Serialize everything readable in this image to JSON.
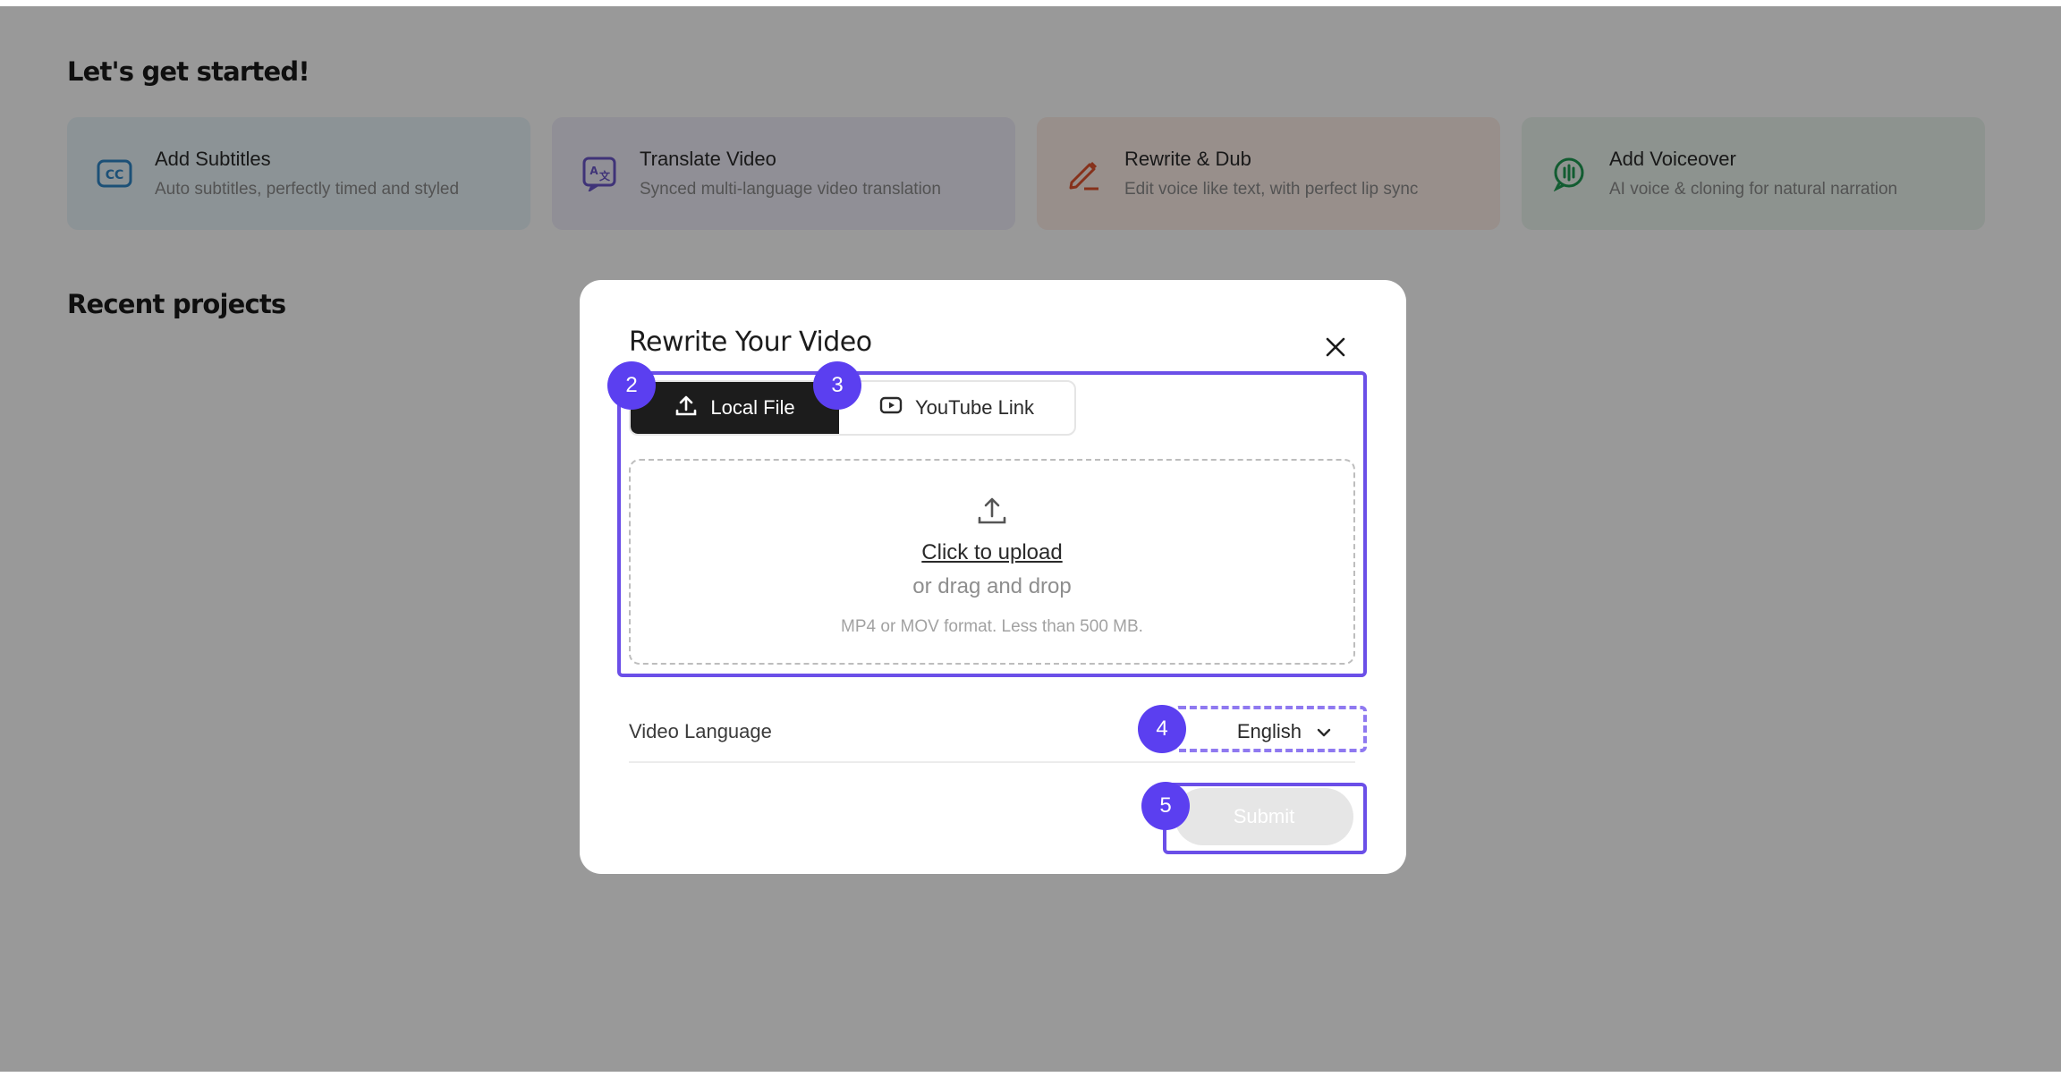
{
  "page": {
    "heading_started": "Let's get started!",
    "heading_recent": "Recent projects"
  },
  "cards": [
    {
      "title": "Add Subtitles",
      "subtitle": "Auto subtitles, perfectly timed and styled",
      "icon": "cc-icon",
      "color": "#2f86c6"
    },
    {
      "title": "Translate Video",
      "subtitle": "Synced multi-language video translation",
      "icon": "translate-icon",
      "color": "#6a55c8"
    },
    {
      "title": "Rewrite & Dub",
      "subtitle": "Edit voice like text, with perfect lip sync",
      "icon": "pen-icon",
      "color": "#e0532d"
    },
    {
      "title": "Add Voiceover",
      "subtitle": "AI voice & cloning for natural narration",
      "icon": "voice-icon",
      "color": "#1f9a53"
    }
  ],
  "modal": {
    "title": "Rewrite Your Video",
    "tabs": {
      "local": "Local File",
      "youtube": "YouTube Link"
    },
    "upload": {
      "link": "Click to upload",
      "drag": "or drag and drop",
      "formats": "MP4 or MOV format. Less than 500 MB."
    },
    "language": {
      "label": "Video Language",
      "value": "English"
    },
    "submit": "Submit"
  },
  "markers": [
    "2",
    "3",
    "4",
    "5"
  ],
  "colors": {
    "highlight": "#6b4fe8",
    "marker": "#5b3ff0"
  }
}
